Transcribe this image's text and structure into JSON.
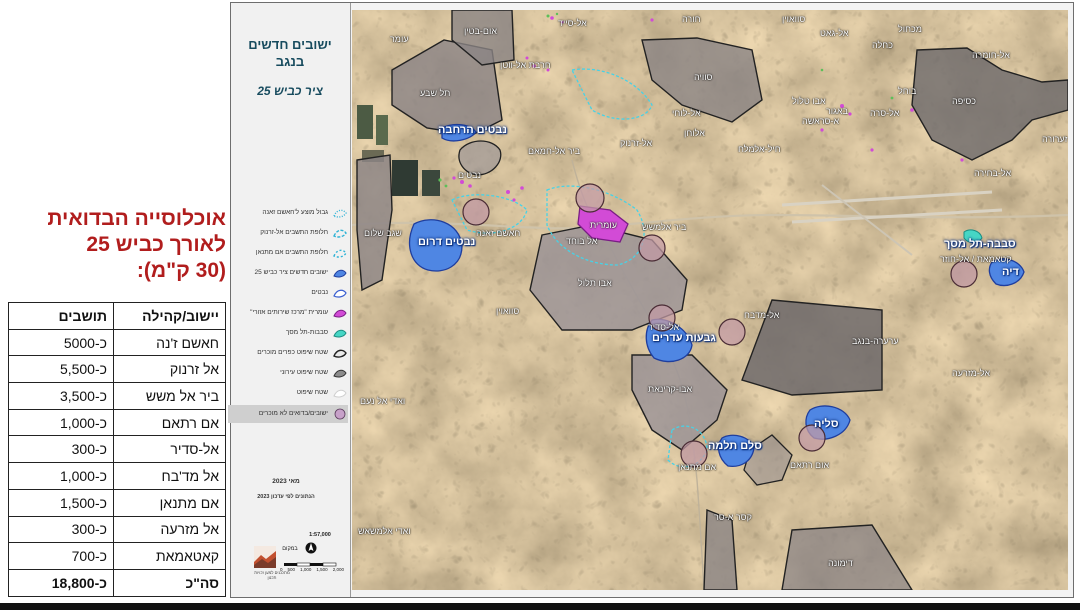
{
  "heading": {
    "line1": "אוכלוסייה הבדואית",
    "line2": "לאורך כביש 25",
    "line3": "(30 ק\"מ):"
  },
  "table": {
    "headers": [
      "יישוב/קהילה",
      "תושבים"
    ],
    "rows": [
      [
        "חאשם ז'נה",
        "כ-5000"
      ],
      [
        "אל זרנוק",
        "כ-5,500"
      ],
      [
        "ביר אל משש",
        "כ-3,500"
      ],
      [
        "אם רתאם",
        "כ-1,000"
      ],
      [
        "אל-סדיר",
        "כ-300"
      ],
      [
        "אל מד'בח",
        "כ-1,000"
      ],
      [
        "אם מתנאן",
        "כ-1,500"
      ],
      [
        "אל מזרעה",
        "כ-300"
      ],
      [
        "קאטאמאת",
        "כ-700"
      ]
    ],
    "total": [
      "סה\"כ",
      "כ-18,800"
    ]
  },
  "map": {
    "title_line1": "ישובים חדשים",
    "title_line2": "בנגב",
    "subtitle": "ציר כביש 25",
    "legend": [
      {
        "label": "גבול מוצע ל'חאשם זאנה",
        "symbol": "dotted-cyan",
        "color": "#2fb3d6"
      },
      {
        "label": "חלופת התשבים אל-זרנוק",
        "symbol": "dashed-cyan",
        "color": "#2fb3d6"
      },
      {
        "label": "חלופת התשבים אם מתנאן",
        "symbol": "dashed-cyan-2",
        "color": "#2fb3d6"
      },
      {
        "label": "ישובים חדשים ציר כביש 25",
        "symbol": "blue-fill",
        "color": "#4f86e3"
      },
      {
        "label": "נבטים",
        "symbol": "blue-outline",
        "color": "#3a5fd0"
      },
      {
        "label": "עומרית \"מרכז שירותים אזורי\"",
        "symbol": "magenta-fill",
        "color": "#d24bd6"
      },
      {
        "label": "סבבות-תל מסך",
        "symbol": "teal-fill",
        "color": "#46d6c5"
      },
      {
        "label": "שטח שיפוט כפרים מוכרים",
        "symbol": "dark-outline",
        "color": "#222222"
      },
      {
        "label": "שטח שיפוט עירוני",
        "symbol": "gray-fill",
        "color": "#8c8c8c"
      },
      {
        "label": "שטח שיפוט",
        "symbol": "white-fill",
        "color": "#ffffff"
      },
      {
        "label": "ישובים/בדואים לא מוכרים",
        "symbol": "purple-dot",
        "color": "#c7a1c9"
      }
    ],
    "date": "מאי 2023",
    "update_note": "הנתונים לפי עדכון 2023",
    "scale": "1:57,000",
    "scale_ticks": [
      "0",
      "500",
      "1,000",
      "1,500",
      "2,000"
    ],
    "logo_name": "במקום",
    "logo_tagline": "מתכננים למען זכויות תכנון",
    "places": [
      {
        "name": "עומר",
        "type": "city"
      },
      {
        "name": "אום-בטין",
        "type": "village"
      },
      {
        "name": "אל-סייד",
        "type": "village"
      },
      {
        "name": "חורה",
        "type": "city"
      },
      {
        "name": "סוואוין",
        "type": "village"
      },
      {
        "name": "אל-גאט",
        "type": "village"
      },
      {
        "name": "כחלה",
        "type": "village"
      },
      {
        "name": "מכחול",
        "type": "village"
      },
      {
        "name": "אל-חומרה",
        "type": "village"
      },
      {
        "name": "תל שבע",
        "type": "city"
      },
      {
        "name": "חרבת אל-ווטן",
        "type": "village"
      },
      {
        "name": "סוויה",
        "type": "village"
      },
      {
        "name": "באגור",
        "type": "village"
      },
      {
        "name": "אל-סרה",
        "type": "village"
      },
      {
        "name": "בוחל",
        "type": "village"
      },
      {
        "name": "כסיפה",
        "type": "city"
      },
      {
        "name": "אבו טלול",
        "type": "village"
      },
      {
        "name": "א-סראשה",
        "type": "village"
      },
      {
        "name": "נבטים הרחבה",
        "type": "new"
      },
      {
        "name": "אלוחן",
        "type": "village"
      },
      {
        "name": "זערורה",
        "type": "village"
      },
      {
        "name": "ביר אל-חמאם",
        "type": "village"
      },
      {
        "name": "אל-זרנוק",
        "type": "village"
      },
      {
        "name": "אל-לוחי",
        "type": "village"
      },
      {
        "name": "חיל-אלמלח",
        "type": "village"
      },
      {
        "name": "נבטים",
        "type": "city"
      },
      {
        "name": "אל-בחירה",
        "type": "village"
      },
      {
        "name": "שגב שלום",
        "type": "city"
      },
      {
        "name": "נבטים דרום",
        "type": "new"
      },
      {
        "name": "חאשם זאנה",
        "type": "village"
      },
      {
        "name": "עומרית",
        "type": "village"
      },
      {
        "name": "ביר אלמשש",
        "type": "village"
      },
      {
        "name": "אל בוחד",
        "type": "village"
      },
      {
        "name": "סבבה-תל מסך",
        "type": "new"
      },
      {
        "name": "קטאמאת / אל-חוזר",
        "type": "village"
      },
      {
        "name": "דיה",
        "type": "new"
      },
      {
        "name": "אבו תלול",
        "type": "city"
      },
      {
        "name": "סוואוין",
        "type": "village"
      },
      {
        "name": "אל-מדבח",
        "type": "village"
      },
      {
        "name": "גבעות עדרים",
        "type": "new"
      },
      {
        "name": "אל-סדיר",
        "type": "village"
      },
      {
        "name": "ערערה-בנגב",
        "type": "city"
      },
      {
        "name": "אל-מזרעה",
        "type": "village"
      },
      {
        "name": "אבו-קרינאת",
        "type": "city"
      },
      {
        "name": "ואדי אל נעם",
        "type": "village"
      },
      {
        "name": "סליה",
        "type": "new"
      },
      {
        "name": "סלם תלמה",
        "type": "new"
      },
      {
        "name": "אם מתנאן",
        "type": "village"
      },
      {
        "name": "אום רתאם",
        "type": "village"
      },
      {
        "name": "ואדי אלמשאש",
        "type": "village"
      },
      {
        "name": "קסר א-סר",
        "type": "village"
      },
      {
        "name": "דימונה",
        "type": "city"
      }
    ]
  }
}
